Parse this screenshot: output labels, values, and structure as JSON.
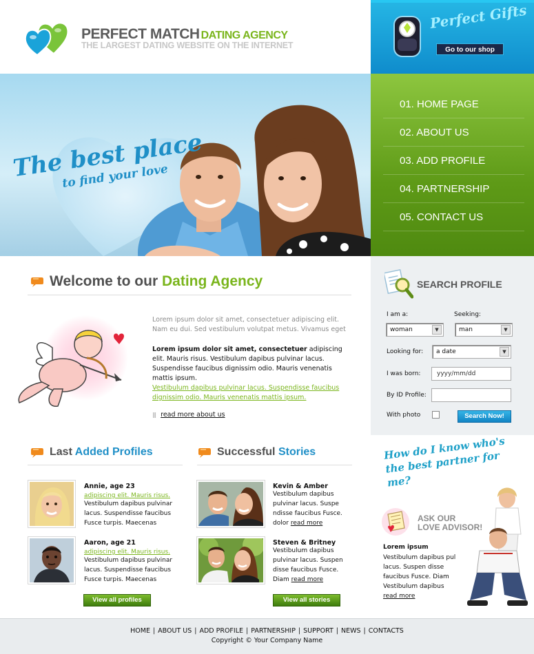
{
  "header": {
    "brand_main": "PERFECT MATCH",
    "brand_suffix": "DATING AGENCY",
    "tagline": "THE LARGEST DATING WEBSITE ON THE INTERNET"
  },
  "gifts": {
    "title": "Perfect Gifts",
    "button": "Go to our shop"
  },
  "hero": {
    "line1": "The best place",
    "line2": "to find your love"
  },
  "nav": {
    "items": [
      {
        "label": "01. HOME PAGE"
      },
      {
        "label": "02. ABOUT US"
      },
      {
        "label": "03. ADD PROFILE"
      },
      {
        "label": "04. PARTNERSHIP"
      },
      {
        "label": "05. CONTACT US"
      }
    ]
  },
  "welcome": {
    "title_main": "Welcome to our",
    "title_accent": "Dating Agency",
    "intro": "Lorem ipsum dolor sit amet, consectetuer adipiscing elit. Nam eu dui. Sed vestibulum volutpat metus. Vivamus eget",
    "body_bold": "Lorem ipsum dolor sit amet, consectetuer",
    "body_rest": " adipiscing elit. Mauris risus. Vestibulum dapibus pulvinar lacus. Suspendisse faucibus dignissim odio. Mauris venenatis mattis ipsum.",
    "link": "Vestibulum dapibus pulvinar lacus. Suspendisse faucibus dignissim odio. Mauris venenatis mattis ipsum.",
    "read_more": "read more about us"
  },
  "search": {
    "title": "SEARCH PROFILE",
    "i_am_label": "I am a:",
    "i_am_value": "woman",
    "seeking_label": "Seeking:",
    "seeking_value": "man",
    "looking_label": "Looking for:",
    "looking_value": "a date",
    "born_label": "I was born:",
    "born_placeholder": "yyyy/mm/dd",
    "id_label": "By ID Profile:",
    "photo_label": "With photo",
    "button": "Search Now!"
  },
  "profiles": {
    "title_main": "Last",
    "title_accent": "Added Profiles",
    "items": [
      {
        "name": "Annie, age 23",
        "link": "adipiscing elit. Mauris risus.",
        "text": "Vestibulum dapibus pulvinar lacus. Suspendisse faucibus Fusce turpis. Maecenas"
      },
      {
        "name": "Aaron, age 21",
        "link": "adipiscing elit. Mauris risus.",
        "text": "Vestibulum dapibus pulvinar lacus. Suspendisse faucibus Fusce turpis. Maecenas"
      }
    ],
    "button": "View all profiles"
  },
  "stories": {
    "title_main": "Successful",
    "title_accent": "Stories",
    "items": [
      {
        "name": "Kevin & Amber",
        "text": "Vestibulum dapibus pulvinar lacus. Suspe ndisse faucibus Fusce. dolor",
        "read_more": "read more"
      },
      {
        "name": "Steven & Britney",
        "text": "Vestibulum dapibus pulvinar lacus. Suspen disse faucibus Fusce. Diam",
        "read_more": "read more"
      }
    ],
    "button": "View all stories"
  },
  "advisor": {
    "question": "How do I know who's the best partner for me?",
    "title_line1": "ASK OUR",
    "title_line2": "LOVE ADVISOR!",
    "lead": "Lorem ipsum",
    "text": "Vestibulum dapibus pul lacus. Suspen disse faucibus Fusce. Diam Vestibulum dapibus",
    "read_more": "read more"
  },
  "footer": {
    "links": [
      "HOME",
      "ABOUT US",
      "ADD PROFILE",
      "PARTNERSHIP",
      "SUPPORT",
      "NEWS",
      "CONTACTS"
    ],
    "copyright": "Copyright © Your Company Name"
  },
  "colors": {
    "green": "#7ab51c",
    "blue": "#1f8fc7",
    "nav_green": "#6aa91f",
    "gifts_blue": "#1a9fd8"
  }
}
